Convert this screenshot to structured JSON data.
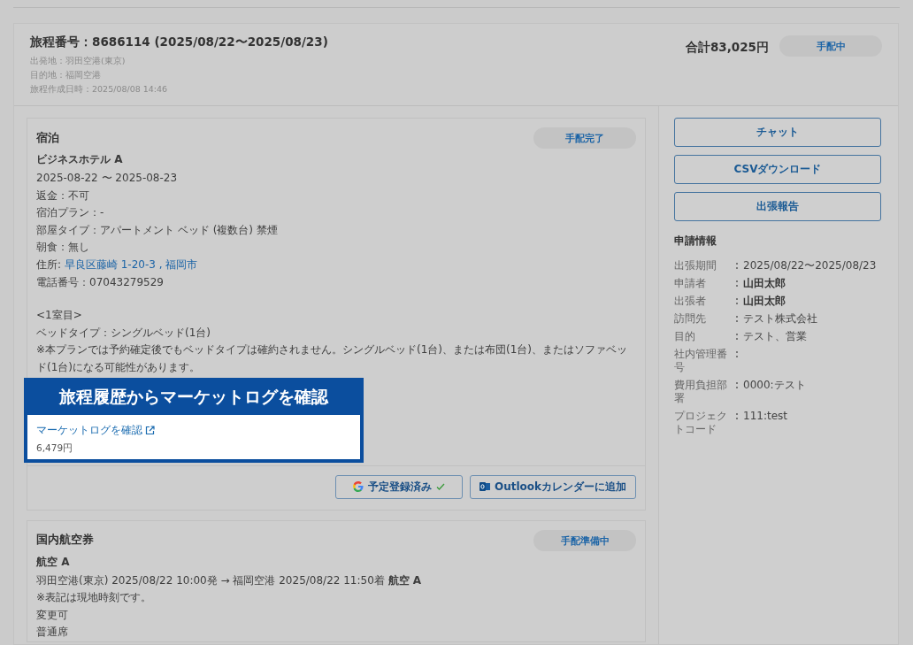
{
  "header": {
    "title": "旅程番号：8686114 (2025/08/22〜2025/08/23)",
    "details": [
      "出発地：羽田空港(東京)",
      "目的地：福岡空港",
      "旅程作成日時：2025/08/08 14:46"
    ],
    "total": "合計83,025円",
    "status": "手配中"
  },
  "bookings": [
    {
      "kind": "hotel",
      "category": "宿泊",
      "status": "手配完了",
      "name": "ビジネスホテル A",
      "paragraphs": [
        [
          {
            "text": "2025-08-22 〜 2025-08-23"
          },
          {
            "text": "返金：不可"
          },
          {
            "text": "宿泊プラン：-"
          },
          {
            "text": "部屋タイプ：アパートメント ベッド (複数台) 禁煙"
          },
          {
            "text": "朝食：無し"
          },
          {
            "text": "住所: ",
            "link": "早良区藤崎 1-20-3 , 福岡市"
          },
          {
            "text": "電話番号：07043279529"
          }
        ],
        [
          {
            "text": "<1室目>"
          },
          {
            "text": "ベッドタイプ：シングルベッド(1台)"
          },
          {
            "text": "※本プランでは予約確定後でもベッドタイプは確約されません。シングルベッド(1台)、または布団(1台)、またはソファベッド(1台)になる可能性があります。"
          }
        ]
      ],
      "calendar_buttons": [
        {
          "kind": "google",
          "label": "予定登録済み",
          "registered": true
        },
        {
          "kind": "outlook",
          "label": "Outlookカレンダーに追加",
          "registered": false
        }
      ]
    },
    {
      "kind": "flight",
      "category": "国内航空券",
      "status": "手配準備中",
      "name": "航空 A",
      "paragraphs": [
        [
          {
            "text": "羽田空港(東京) 2025/08/22 10:00発 → 福岡空港 2025/08/22 11:50着 **航空 A**"
          },
          {
            "text": "※表記は現地時刻です。"
          },
          {
            "text": "変更可"
          },
          {
            "text": "普通席"
          }
        ]
      ]
    }
  ],
  "side_buttons": [
    "チャット",
    "CSVダウンロード",
    "出張報告"
  ],
  "application": {
    "title": "申請情報",
    "rows": [
      {
        "label": "出張期間",
        "value": "2025/08/22〜2025/08/23",
        "bold": false
      },
      {
        "label": "申請者",
        "value": "山田太郎",
        "bold": true
      },
      {
        "label": "出張者",
        "value": "山田太郎",
        "bold": true
      },
      {
        "label": "訪問先",
        "value": "テスト株式会社",
        "bold": false
      },
      {
        "label": "目的",
        "value": "テスト、営業",
        "bold": false
      },
      {
        "label": "社内管理番号"
      },
      {
        "label": "費用負担部署",
        "value": "0000:テスト",
        "bold": false
      },
      {
        "label": "プロジェクトコード",
        "value": "111:test",
        "bold": false
      }
    ]
  },
  "callout": {
    "title": "旅程履歴からマーケットログを確認",
    "link": "マーケットログを確認",
    "price": "6,479円"
  }
}
